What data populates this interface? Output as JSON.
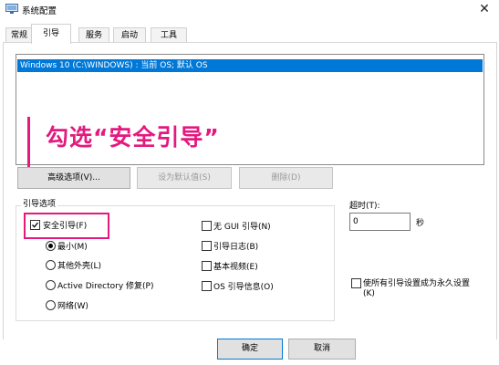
{
  "window": {
    "title": "系统配置",
    "close_glyph": "✕"
  },
  "tabs": [
    {
      "label": "常规",
      "active": false
    },
    {
      "label": "引导",
      "active": true
    },
    {
      "label": "服务",
      "active": false
    },
    {
      "label": "启动",
      "active": false
    },
    {
      "label": "工具",
      "active": false
    }
  ],
  "os_list": {
    "items": [
      "Windows 10 (C:\\WINDOWS) : 当前 OS; 默认 OS"
    ],
    "selected_index": 0,
    "selection_color": "#0078d7"
  },
  "annotation": {
    "text": "勾选“安全引导”",
    "color": "#e4197e"
  },
  "buttons": {
    "advanced": "高级选项(V)...",
    "set_default": "设为默认值(S)",
    "delete": "删除(D)",
    "ok": "确定",
    "cancel": "取消"
  },
  "boot_options": {
    "group_label": "引导选项",
    "safe_boot": {
      "label": "安全引导(F)",
      "checked": true
    },
    "safe_boot_modes": [
      {
        "label": "最小(M)",
        "selected": true
      },
      {
        "label": "其他外壳(L)",
        "selected": false
      },
      {
        "label": "Active Directory 修复(P)",
        "selected": false
      },
      {
        "label": "网络(W)",
        "selected": false
      }
    ],
    "right_checkboxes": [
      {
        "label": "无 GUI 引导(N)",
        "checked": false
      },
      {
        "label": "引导日志(B)",
        "checked": false
      },
      {
        "label": "基本视频(E)",
        "checked": false
      },
      {
        "label": "OS 引导信息(O)",
        "checked": false
      }
    ]
  },
  "timeout": {
    "label": "超时(T):",
    "value": "0",
    "unit": "秒"
  },
  "permanent": {
    "label_line1": "使所有引导设置成为永久设置",
    "label_line2": "(K)",
    "checked": false
  },
  "icons": {
    "window_icon": "system-config-icon",
    "close": "close-icon"
  }
}
